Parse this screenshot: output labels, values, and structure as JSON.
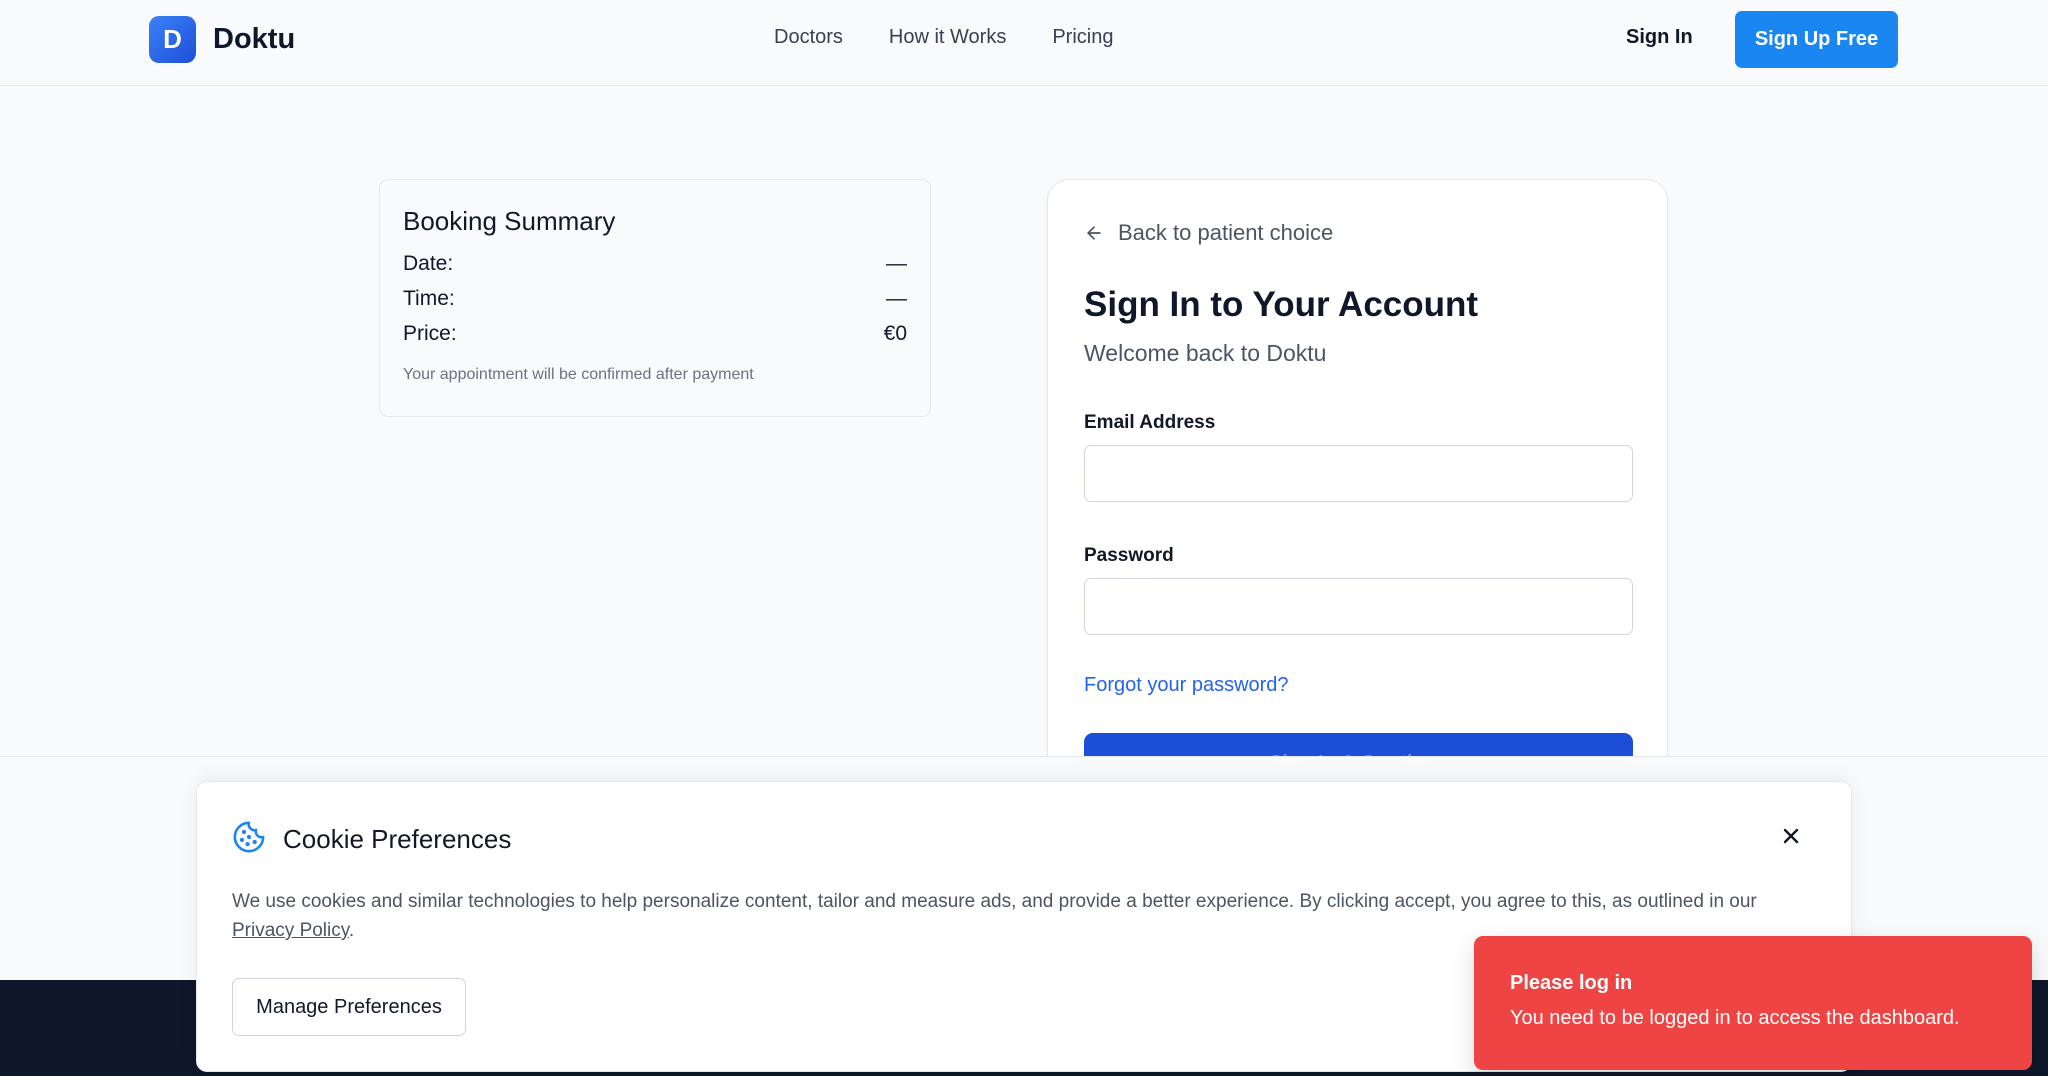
{
  "brand": {
    "logo_letter": "D",
    "name": "Doktu",
    "accent": "#1a86f2"
  },
  "nav": {
    "items": [
      "Doctors",
      "How it Works",
      "Pricing"
    ]
  },
  "header": {
    "signin_label": "Sign In",
    "signup_label": "Sign Up Free"
  },
  "booking_summary": {
    "title": "Booking Summary",
    "rows": [
      {
        "label": "Date:",
        "value": "—"
      },
      {
        "label": "Time:",
        "value": "—"
      },
      {
        "label": "Price:",
        "value": "€0"
      }
    ],
    "note": "Your appointment will be confirmed after payment"
  },
  "signin_card": {
    "back_label": "Back to patient choice",
    "title": "Sign In to Your Account",
    "subtitle": "Welcome back to Doktu",
    "email_label": "Email Address",
    "email_value": "",
    "password_label": "Password",
    "password_value": "",
    "forgot_label": "Forgot your password?",
    "submit_label": "Sign In & Continue",
    "submit_color": "#1d4ed8"
  },
  "cookie_banner": {
    "title": "Cookie Preferences",
    "icon": "cookie-icon",
    "text_before": "We use cookies and similar technologies to help personalize content, tailor and measure ads, and provide a better experience. By clicking accept, you agree to this, as outlined in our ",
    "policy_link": "Privacy Policy",
    "text_after": ".",
    "manage_label": "Manage Preferences"
  },
  "toast": {
    "title": "Please log in",
    "message": "You need to be logged in to access the dashboard.",
    "color": "#ef4444"
  }
}
